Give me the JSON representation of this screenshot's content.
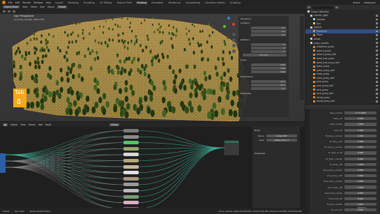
{
  "topbar": {
    "app_menus": [
      "File",
      "Edit",
      "Render",
      "Window",
      "Help"
    ],
    "workspaces": [
      "Layout",
      "Modeling",
      "Sculpting",
      "UV Editing",
      "Texture Paint",
      "Shading",
      "Animation",
      "Rendering",
      "Compositing",
      "Geometry Nodes",
      "Scripting"
    ],
    "active_workspace": "Shading",
    "scene_label": "Scene",
    "view_layer_label": "ViewLayer"
  },
  "viewport": {
    "mode": "Object Mode",
    "menus": [
      "View",
      "Select",
      "Add",
      "Object"
    ],
    "transform": "Global",
    "view_name": "User Perspective",
    "collection_info": "(1) proxy_models | Plane.001",
    "thumbnail_text": "Tab"
  },
  "npanel": {
    "title": "Transform",
    "location_label": "Location:",
    "rotation_label": "Rotation:",
    "scale_label": "Scale:",
    "dimensions_label": "Dimensions:",
    "rotation_mode": "XYZ Euler",
    "axes": [
      "X",
      "Y",
      "Z"
    ],
    "location": [
      "0 m",
      "0 m",
      "0 m"
    ],
    "rotation": [
      "0°",
      "0°",
      "0°"
    ],
    "scale": [
      "1.000",
      "1.000",
      "1.000"
    ],
    "dimensions": [
      "40 m",
      "40 m",
      "0 m"
    ],
    "properties_label": "Properties"
  },
  "node_editor": {
    "header_items": [
      "Object",
      "View",
      "Select",
      "Add",
      "Node"
    ],
    "use_nodes": "Nodes",
    "side_title": "Node",
    "name_label": "Name",
    "name_value": "Group.007",
    "label_label": "Label",
    "label_value": "plane_lines_1",
    "properties_label": "Properties",
    "node_colors": [
      "#7a7a7a",
      "#8c8c8c",
      "#56c36b",
      "#9aa56a",
      "#d8d8d8",
      "#b5a47c",
      "#c8b898",
      "#e0e0e0",
      "#a89880",
      "#9a9a9a",
      "#bbbbbb",
      "#7b9a78",
      "#d8b0c4",
      "#d94aa0"
    ]
  },
  "statusbar": {
    "items": [
      "Select",
      "Pan View",
      "Node Context Menu"
    ],
    "info": "proxy_models | Objects:0/40,080 | Verts:4,254,780 | Faces:4,170,800 | Tris:8,441,600"
  },
  "outliner": {
    "scene_collection": "Scene Collection",
    "items": [
      {
        "name": "Camera_light",
        "color": "#c7c7c7",
        "indent": 1,
        "selected": false
      },
      {
        "name": "Camera",
        "color": "#8fd9ff",
        "indent": 2,
        "selected": false
      },
      {
        "name": "Sun",
        "color": "#e3d25d",
        "indent": 2,
        "selected": false
      },
      {
        "name": "ground",
        "color": "#c7c7c7",
        "indent": 1,
        "selected": false
      },
      {
        "name": "Plane.001",
        "color": "#e58a2e",
        "indent": 2,
        "selected": true
      },
      {
        "name": "Plane",
        "color": "#e58a2e",
        "indent": 2,
        "selected": false
      },
      {
        "name": "plants",
        "color": "#c7c7c7",
        "indent": 1,
        "selected": false
      },
      {
        "name": "proxy_models",
        "color": "#c7c7c7",
        "indent": 1,
        "selected": false
      },
      {
        "name": "Icosphere_proxy",
        "color": "#e58a2e",
        "indent": 2,
        "selected": false
      },
      {
        "name": "branch_proxy",
        "color": "#e58a2e",
        "indent": 2,
        "selected": false
      },
      {
        "name": "branch_proxy_ball",
        "color": "#e58a2e",
        "indent": 2,
        "selected": false
      },
      {
        "name": "dead_tree_proxy",
        "color": "#e58a2e",
        "indent": 2,
        "selected": false
      },
      {
        "name": "dead_tree_proxy_ball",
        "color": "#e58a2e",
        "indent": 2,
        "selected": false
      },
      {
        "name": "grass_proxy",
        "color": "#e58a2e",
        "indent": 2,
        "selected": false
      },
      {
        "name": "grass_proxy_ball",
        "color": "#e58a2e",
        "indent": 2,
        "selected": false
      },
      {
        "name": "moss_proxy",
        "color": "#e58a2e",
        "indent": 2,
        "selected": false
      },
      {
        "name": "moss_proxy_ball",
        "color": "#e58a2e",
        "indent": 2,
        "selected": false
      },
      {
        "name": "pine_proxy",
        "color": "#e58a2e",
        "indent": 2,
        "selected": false
      },
      {
        "name": "pine_proxy_ball",
        "color": "#e58a2e",
        "indent": 2,
        "selected": false
      },
      {
        "name": "rock_proxy",
        "color": "#e58a2e",
        "indent": 2,
        "selected": false
      },
      {
        "name": "rock_proxy_ball",
        "color": "#e58a2e",
        "indent": 2,
        "selected": false
      },
      {
        "name": "shrub_proxy",
        "color": "#e58a2e",
        "indent": 2,
        "selected": false
      },
      {
        "name": "shrub_proxy_ball",
        "color": "#e58a2e",
        "indent": 2,
        "selected": false
      },
      {
        "name": "tree_proxy",
        "color": "#e58a2e",
        "indent": 2,
        "selected": false
      }
    ]
  },
  "properties": {
    "rows": [
      {
        "label": "layer_render",
        "value": "1.77-3040"
      },
      {
        "label": "Index_VP",
        "value": "0.000"
      },
      {
        "label": "bush_render",
        "value": "0.000"
      },
      {
        "label": "bush_VP",
        "value": "0.000"
      },
      {
        "label": "fir_tree_s_render",
        "value": "0.000"
      },
      {
        "label": "fir_tree_s_VP",
        "value": "0.000"
      },
      {
        "label": "fir_tree_m_render",
        "value": "0.000"
      },
      {
        "label": "fir_tree_m_VP",
        "value": "0.000"
      },
      {
        "label": "fir_tree_l_render",
        "value": "0.000"
      },
      {
        "label": "fir_tree_l_VP",
        "value": "0.000"
      },
      {
        "label": "pine_tree_s_render",
        "value": "0.000"
      },
      {
        "label": "pine_tree_s_VP",
        "value": "0.000"
      },
      {
        "label": "pine_tree_l_render",
        "value": "0.000"
      },
      {
        "label": "pine_tree_l_VP",
        "value": "0.000"
      },
      {
        "label": "dead_tree_render",
        "value": "0.000"
      },
      {
        "label": "dead_tree_VP",
        "value": "0.000"
      },
      {
        "label": "fir_burn_render",
        "value": "0.000"
      },
      {
        "label": "fir_burn_VP",
        "value": "0.000"
      }
    ]
  },
  "watermark": "Udemy",
  "colors": {
    "accent_orange": "#e87d0d",
    "selection_blue": "#334d80",
    "wire_green": "#3fb89a",
    "terrain_ground": "#b39a5c",
    "tree_dark": "#273d17",
    "flower_orange": "#f2a11a"
  }
}
